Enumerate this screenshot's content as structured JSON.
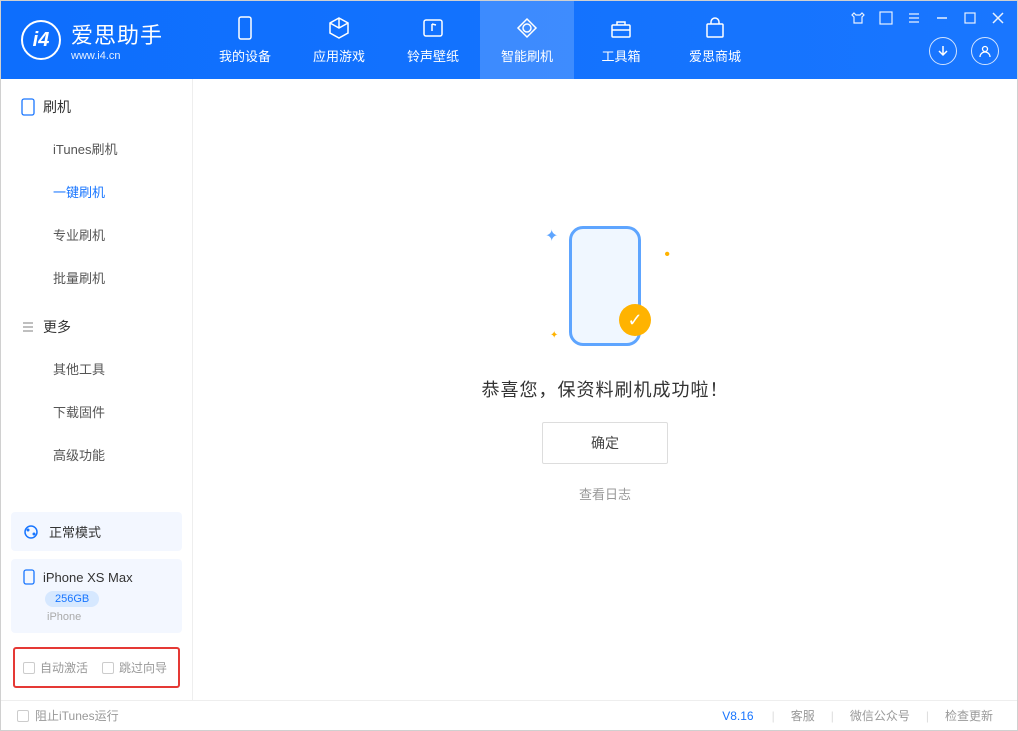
{
  "app": {
    "title": "爱思助手",
    "subtitle": "www.i4.cn"
  },
  "nav": [
    {
      "label": "我的设备",
      "icon": "device"
    },
    {
      "label": "应用游戏",
      "icon": "cube"
    },
    {
      "label": "铃声壁纸",
      "icon": "music"
    },
    {
      "label": "智能刷机",
      "icon": "refresh",
      "active": true
    },
    {
      "label": "工具箱",
      "icon": "toolbox"
    },
    {
      "label": "爱思商城",
      "icon": "shop"
    }
  ],
  "sidebar": {
    "section1": {
      "title": "刷机",
      "items": [
        {
          "label": "iTunes刷机"
        },
        {
          "label": "一键刷机",
          "active": true
        },
        {
          "label": "专业刷机"
        },
        {
          "label": "批量刷机"
        }
      ]
    },
    "section2": {
      "title": "更多",
      "items": [
        {
          "label": "其他工具"
        },
        {
          "label": "下载固件"
        },
        {
          "label": "高级功能"
        }
      ]
    },
    "mode": "正常模式",
    "device": {
      "name": "iPhone XS Max",
      "storage": "256GB",
      "type": "iPhone"
    },
    "checkboxes": {
      "auto_activate": "自动激活",
      "skip_guide": "跳过向导"
    }
  },
  "main": {
    "message": "恭喜您，保资料刷机成功啦！",
    "ok_button": "确定",
    "log_link": "查看日志"
  },
  "statusbar": {
    "block_itunes": "阻止iTunes运行",
    "version": "V8.16",
    "links": [
      "客服",
      "微信公众号",
      "检查更新"
    ]
  }
}
